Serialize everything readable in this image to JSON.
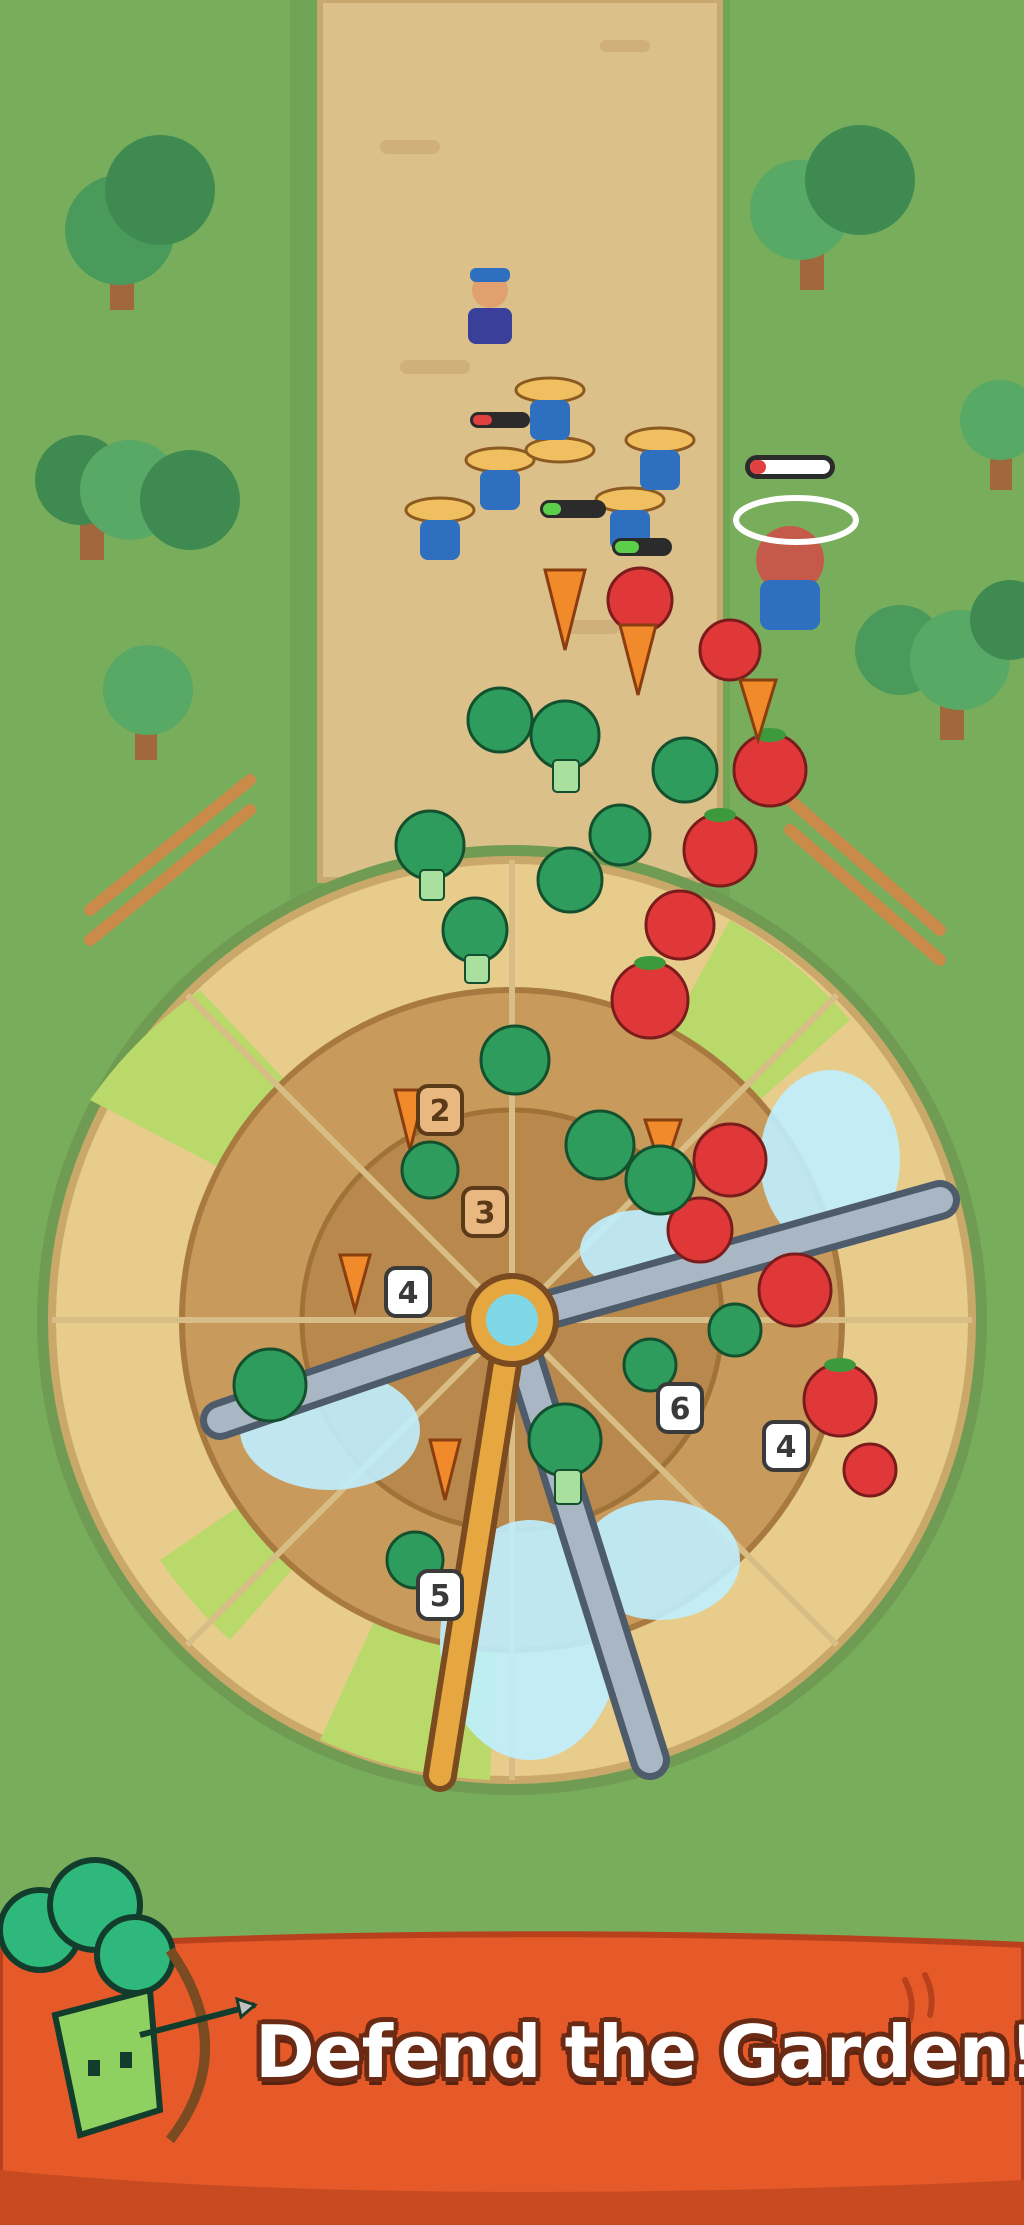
{
  "banner": {
    "text": "Defend the Garden!",
    "color": "#e65a2a"
  },
  "plot_badges": [
    "2",
    "3",
    "4",
    "6",
    "4",
    "5"
  ],
  "health_bars": [
    {
      "unit": "farmer-top",
      "level": 0.35,
      "color": "#e04040"
    },
    {
      "unit": "farmer-mid",
      "level": 0.3,
      "color": "#5ccf4a"
    },
    {
      "unit": "farmer-mid2",
      "level": 0.45,
      "color": "#5ccf4a"
    },
    {
      "unit": "boss",
      "level": 0.2,
      "color": "#e04040"
    }
  ],
  "colors": {
    "grass": "#78ad5c",
    "path": "#dcc08a",
    "garden_ring": "#e8cc8c",
    "soil": "#c89a5c",
    "tomato": "#e03838",
    "broccoli": "#2e9c5c",
    "water": "#bff0ff"
  }
}
